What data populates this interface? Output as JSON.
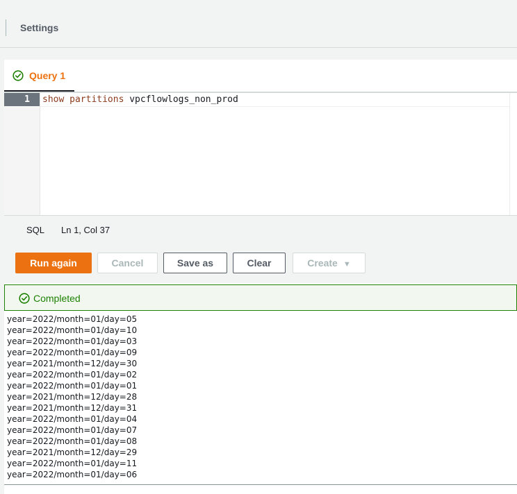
{
  "header": {
    "settings_label": "Settings"
  },
  "tabs": [
    {
      "label": "Query 1",
      "status": "success"
    }
  ],
  "editor": {
    "line_number": "1",
    "keywords": "show partitions",
    "identifier": "vpcflowlogs_non_prod"
  },
  "statusbar": {
    "language": "SQL",
    "cursor_position": "Ln 1, Col 37"
  },
  "actions": {
    "run_again": "Run again",
    "cancel": "Cancel",
    "save_as": "Save as",
    "clear": "Clear",
    "create": "Create",
    "create_caret": "▼"
  },
  "result_status": {
    "label": "Completed"
  },
  "results": [
    "year=2022/month=01/day=05",
    "year=2022/month=01/day=10",
    "year=2022/month=01/day=03",
    "year=2022/month=01/day=09",
    "year=2021/month=12/day=30",
    "year=2022/month=01/day=02",
    "year=2022/month=01/day=01",
    "year=2021/month=12/day=28",
    "year=2021/month=12/day=31",
    "year=2022/month=01/day=04",
    "year=2022/month=01/day=07",
    "year=2022/month=01/day=08",
    "year=2021/month=12/day=29",
    "year=2022/month=01/day=11",
    "year=2022/month=01/day=06"
  ],
  "colors": {
    "accent": "#ec7211",
    "success": "#1d8102",
    "text": "#16191f"
  },
  "icons": {
    "tab_status": "check-circle-icon",
    "completed_status": "check-circle-icon",
    "create_dropdown": "caret-down-icon"
  }
}
